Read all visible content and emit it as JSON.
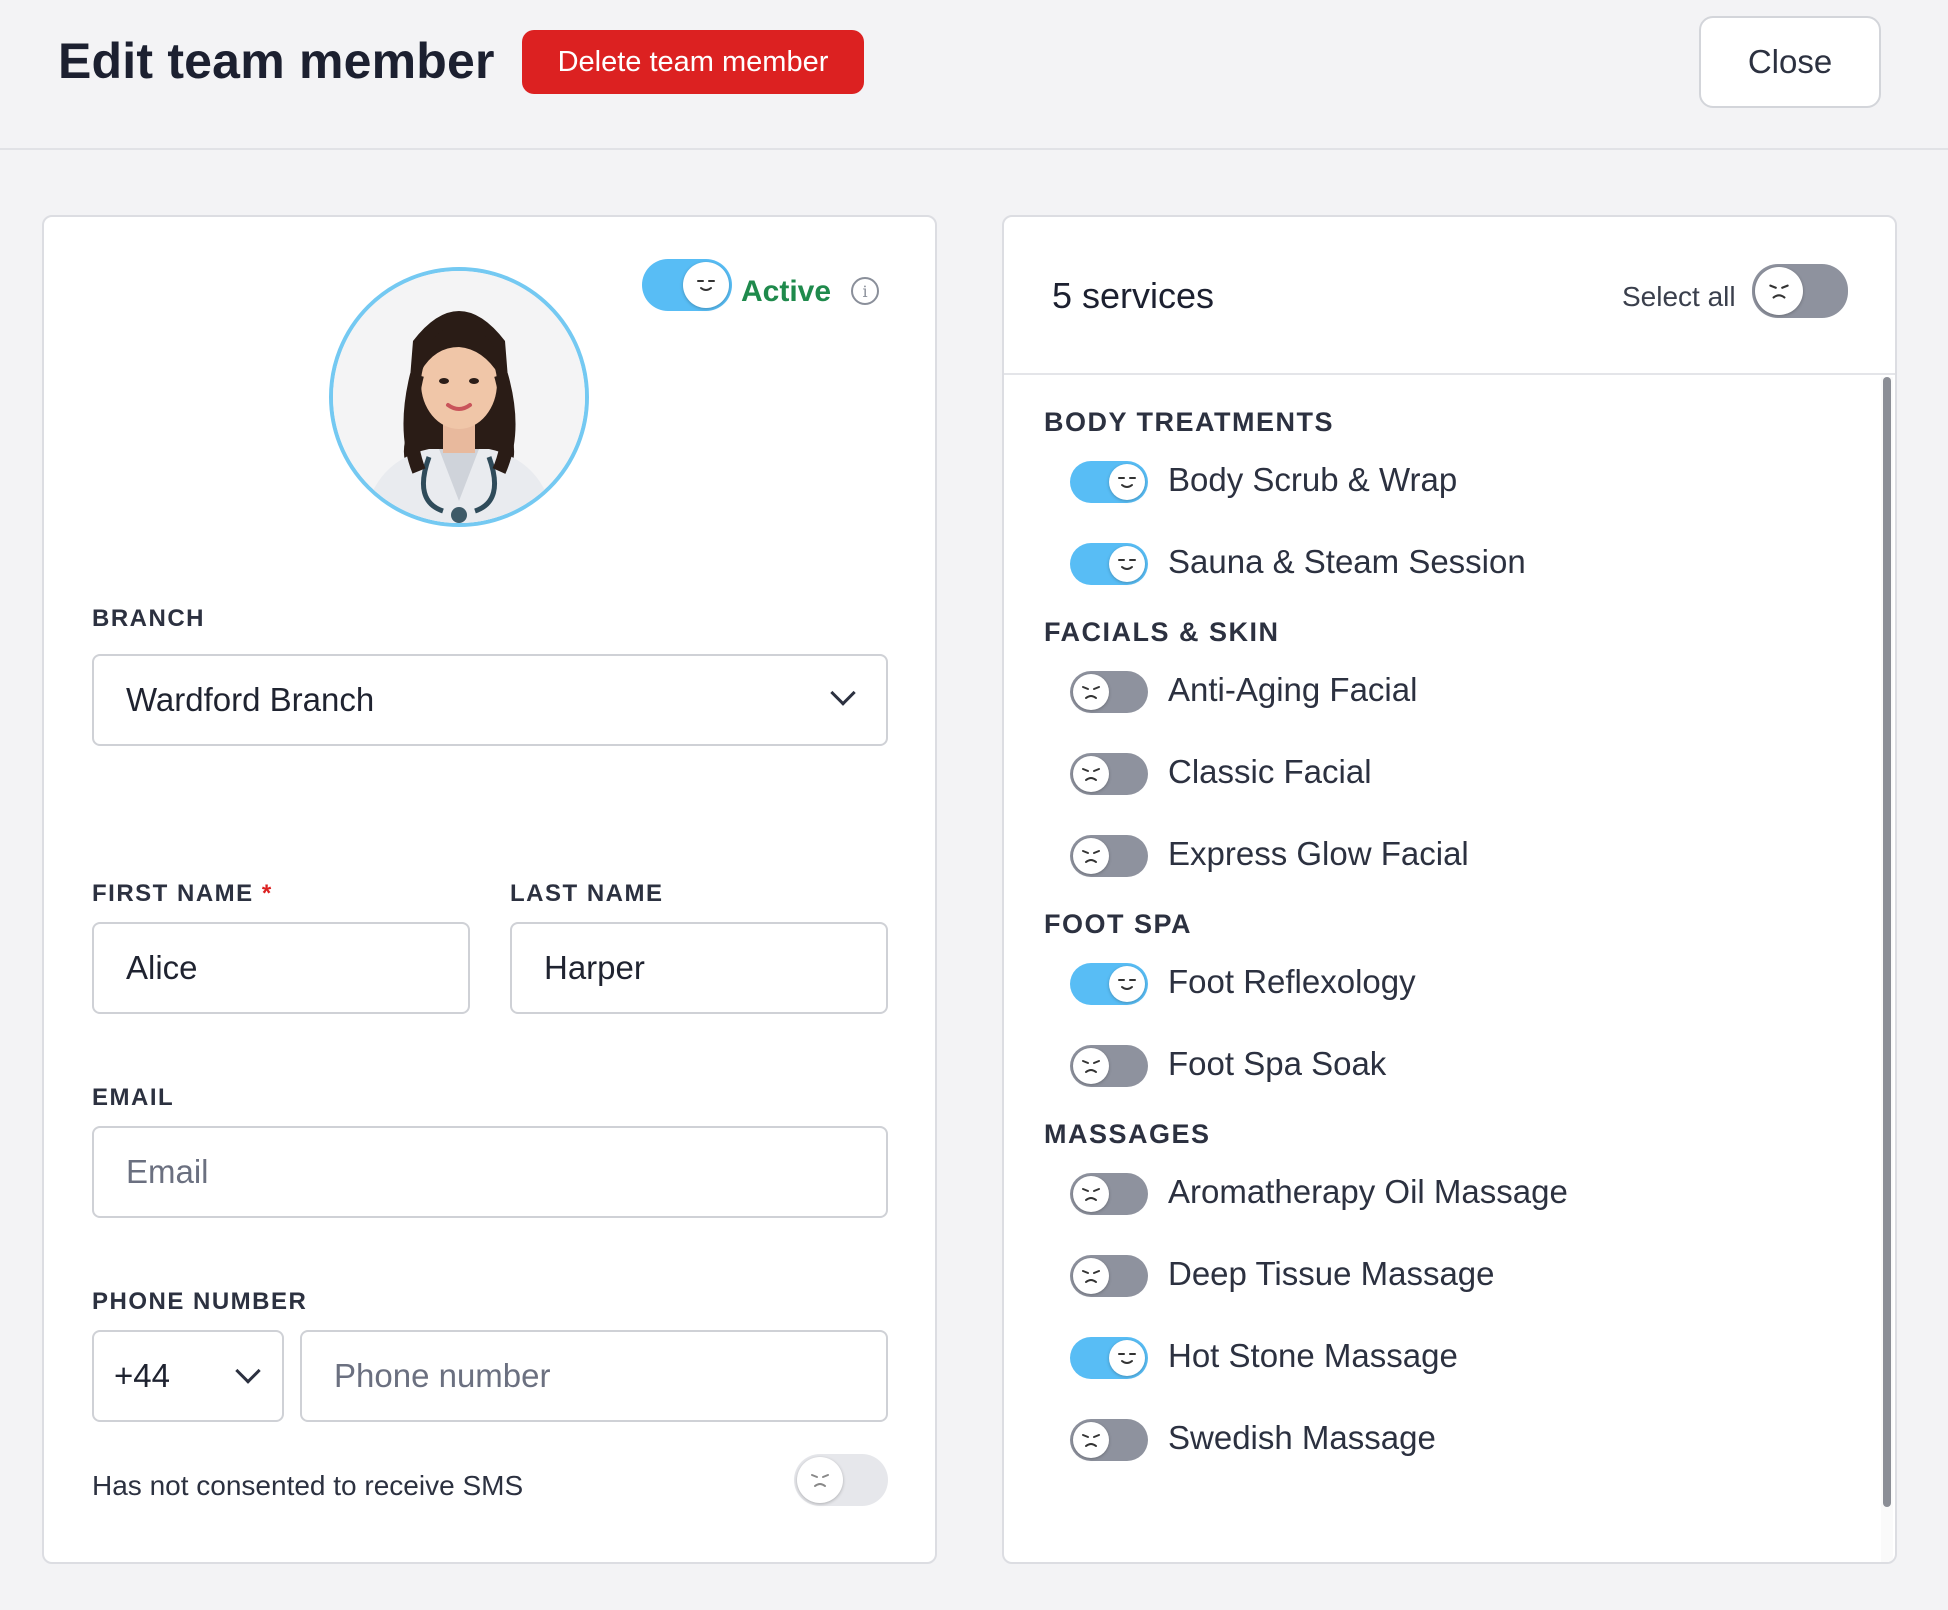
{
  "header": {
    "title": "Edit team member",
    "delete_label": "Delete team member",
    "close_label": "Close"
  },
  "profile": {
    "status_label": "Active",
    "status_on": true
  },
  "form": {
    "branch_label": "BRANCH",
    "branch_value": "Wardford Branch",
    "first_name_label": "FIRST NAME",
    "first_name_required": "*",
    "first_name_value": "Alice",
    "last_name_label": "LAST NAME",
    "last_name_value": "Harper",
    "email_label": "EMAIL",
    "email_placeholder": "Email",
    "phone_label": "PHONE NUMBER",
    "phone_code": "+44",
    "phone_placeholder": "Phone number",
    "sms_label": "Has not consented to receive SMS",
    "sms_on": false
  },
  "services": {
    "count_label": "5 services",
    "select_all_label": "Select all",
    "select_all_on": false,
    "groups": [
      {
        "title": "BODY TREATMENTS",
        "items": [
          {
            "name": "Body Scrub & Wrap",
            "on": true
          },
          {
            "name": "Sauna & Steam Session",
            "on": true
          }
        ]
      },
      {
        "title": "FACIALS & SKIN",
        "items": [
          {
            "name": "Anti-Aging Facial",
            "on": false
          },
          {
            "name": "Classic Facial",
            "on": false
          },
          {
            "name": "Express Glow Facial",
            "on": false
          }
        ]
      },
      {
        "title": "FOOT SPA",
        "items": [
          {
            "name": "Foot Reflexology",
            "on": true
          },
          {
            "name": "Foot Spa Soak",
            "on": false
          }
        ]
      },
      {
        "title": "MASSAGES",
        "items": [
          {
            "name": "Aromatherapy Oil Massage",
            "on": false
          },
          {
            "name": "Deep Tissue Massage",
            "on": false
          },
          {
            "name": "Hot Stone Massage",
            "on": true
          },
          {
            "name": "Swedish Massage",
            "on": false
          }
        ]
      }
    ]
  },
  "colors": {
    "accent": "#58bdf5",
    "danger": "#dc2121",
    "active_text": "#1f8a4c"
  }
}
